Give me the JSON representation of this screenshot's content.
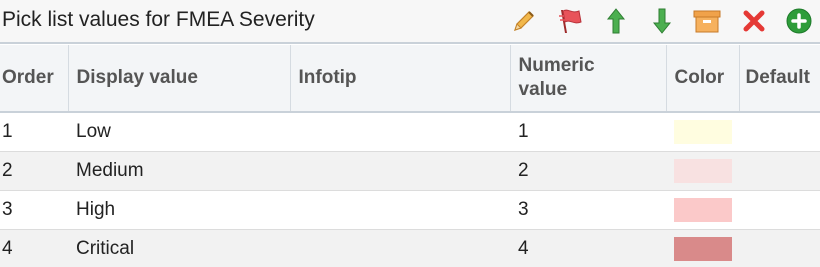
{
  "header": {
    "title": "Pick list values for FMEA Severity"
  },
  "toolbar": {
    "icons": [
      "pencil-icon",
      "flag-icon",
      "arrow-up-icon",
      "arrow-down-icon",
      "archive-icon",
      "delete-icon",
      "add-icon"
    ],
    "colors": {
      "pencil": "#e7a83d",
      "flag": "#e8535a",
      "up": "#4caf50",
      "down": "#4caf50",
      "archive": "#f0a24a",
      "delete": "#e53935",
      "add": "#2e9d3a"
    }
  },
  "table": {
    "columns": {
      "order": "Order",
      "display_value": "Display value",
      "infotip": "Infotip",
      "numeric_value_line1": "Numeric",
      "numeric_value_line2": "value",
      "color": "Color",
      "default": "Default"
    },
    "rows": [
      {
        "order": "1",
        "display_value": "Low",
        "infotip": "",
        "numeric_value": "1",
        "color": "#fffde0",
        "default": ""
      },
      {
        "order": "2",
        "display_value": "Medium",
        "infotip": "",
        "numeric_value": "2",
        "color": "#f8e1e1",
        "default": ""
      },
      {
        "order": "3",
        "display_value": "High",
        "infotip": "",
        "numeric_value": "3",
        "color": "#fbc9c9",
        "default": ""
      },
      {
        "order": "4",
        "display_value": "Critical",
        "infotip": "",
        "numeric_value": "4",
        "color": "#d98a8a",
        "default": ""
      }
    ]
  }
}
